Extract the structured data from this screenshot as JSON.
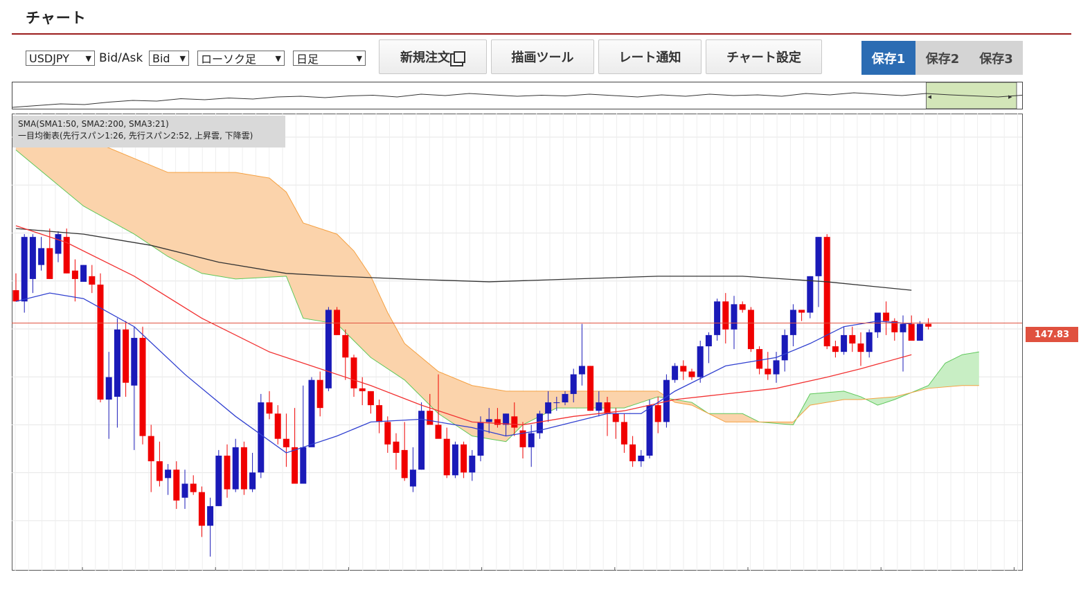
{
  "header": {
    "title": "チャート"
  },
  "toolbar": {
    "symbol_select": "USDJPY",
    "bidask_label": "Bid/Ask",
    "bidask_select": "Bid",
    "chart_type_select": "ローソク足",
    "period_select": "日足",
    "new_order_button": "新規注文",
    "draw_tool_button": "描画ツール",
    "rate_alert_button": "レート通知",
    "chart_settings_button": "チャート設定",
    "save1": "保存1",
    "save2": "保存2",
    "save3": "保存3"
  },
  "legend": {
    "line1": "SMA(SMA1:50, SMA2:200, SMA3:21)",
    "line2": "一目均衡表(先行スパン1:26, 先行スパン2:52, 上昇雲, 下降雲)"
  },
  "current_price": "147.83",
  "colors": {
    "up_candle": "#1a1ab8",
    "down_candle": "#f00000",
    "sma50": "#f23030",
    "sma200": "#333333",
    "sma21": "#3040d0",
    "cloud_down": "#fbd3ab",
    "cloud_up": "#c8eec4",
    "span1": "#5ec85a",
    "span2": "#f5a040",
    "accent": "#2b6cb3",
    "header_rule": "#9b1c1c"
  },
  "chart_data": {
    "type": "candlestick",
    "symbol": "USDJPY",
    "ylim": [
      139.0,
      155.3
    ],
    "y_ticks": [
      "154.46",
      "152.75",
      "151.04",
      "149.33",
      "147.62",
      "145.91",
      "144.20",
      "142.49",
      "140.78"
    ],
    "x_ticks": [
      "2025/04/02",
      "2025/04/23",
      "2025/05/14",
      "2025/06/04",
      "2025/06/25",
      "2025/07/16",
      "2025/08/06",
      "2025/08/25"
    ],
    "current_price": 147.83,
    "candles": [
      [
        149.0,
        149.6,
        148.6,
        148.6
      ],
      [
        148.6,
        151.0,
        148.2,
        150.9
      ],
      [
        149.4,
        151.0,
        148.9,
        150.9
      ],
      [
        149.9,
        150.9,
        149.7,
        150.5
      ],
      [
        150.5,
        151.2,
        149.4,
        149.4
      ],
      [
        150.3,
        151.1,
        150.0,
        151.0
      ],
      [
        150.9,
        151.2,
        149.6,
        149.6
      ],
      [
        149.7,
        150.1,
        148.6,
        149.4
      ],
      [
        149.3,
        149.9,
        149.4,
        149.9
      ],
      [
        149.5,
        149.9,
        148.9,
        149.2
      ],
      [
        149.2,
        149.6,
        145.0,
        145.1
      ],
      [
        145.1,
        146.8,
        143.7,
        145.9
      ],
      [
        145.2,
        148.0,
        144.1,
        147.6
      ],
      [
        147.6,
        147.9,
        145.2,
        145.7
      ],
      [
        145.6,
        147.7,
        143.3,
        147.3
      ],
      [
        147.3,
        147.7,
        143.5,
        143.8
      ],
      [
        143.8,
        144.2,
        141.8,
        142.9
      ],
      [
        142.9,
        143.6,
        142.0,
        142.2
      ],
      [
        142.3,
        142.8,
        141.7,
        142.6
      ],
      [
        142.6,
        142.9,
        141.2,
        141.5
      ],
      [
        141.6,
        142.6,
        141.2,
        142.1
      ],
      [
        142.1,
        142.4,
        141.7,
        141.8
      ],
      [
        141.8,
        142.0,
        140.2,
        140.6
      ],
      [
        140.6,
        141.6,
        139.5,
        141.3
      ],
      [
        141.3,
        143.3,
        141.3,
        143.1
      ],
      [
        143.1,
        143.5,
        141.6,
        141.9
      ],
      [
        141.9,
        143.7,
        141.8,
        143.4
      ],
      [
        143.4,
        143.6,
        141.7,
        141.9
      ],
      [
        141.9,
        143.2,
        141.8,
        142.5
      ],
      [
        142.5,
        145.3,
        142.3,
        145.0
      ],
      [
        145.0,
        145.4,
        144.4,
        144.6
      ],
      [
        144.6,
        144.9,
        143.5,
        143.7
      ],
      [
        143.7,
        144.6,
        142.7,
        143.4
      ],
      [
        143.4,
        144.8,
        142.4,
        142.1
      ],
      [
        142.1,
        145.6,
        143.2,
        143.4
      ],
      [
        143.4,
        145.9,
        143.5,
        145.8
      ],
      [
        145.8,
        146.1,
        144.5,
        144.8
      ],
      [
        145.5,
        148.4,
        145.4,
        148.3
      ],
      [
        148.3,
        148.4,
        147.4,
        147.4
      ],
      [
        147.4,
        147.6,
        145.8,
        146.6
      ],
      [
        146.6,
        146.7,
        145.2,
        145.5
      ],
      [
        145.5,
        145.9,
        144.9,
        145.4
      ],
      [
        145.4,
        145.4,
        144.6,
        144.9
      ],
      [
        144.9,
        145.1,
        143.9,
        144.3
      ],
      [
        144.3,
        144.5,
        143.2,
        143.5
      ],
      [
        143.6,
        143.9,
        142.6,
        143.2
      ],
      [
        143.3,
        144.3,
        142.2,
        142.3
      ],
      [
        142.0,
        143.4,
        141.8,
        142.6
      ],
      [
        142.6,
        145.0,
        142.6,
        144.7
      ],
      [
        144.7,
        145.3,
        144.3,
        144.2
      ],
      [
        144.2,
        146.0,
        143.8,
        143.7
      ],
      [
        143.7,
        144.1,
        142.3,
        142.4
      ],
      [
        142.4,
        143.6,
        142.3,
        143.5
      ],
      [
        143.5,
        143.6,
        142.3,
        142.5
      ],
      [
        142.5,
        143.3,
        142.2,
        143.1
      ],
      [
        143.1,
        144.5,
        142.9,
        144.3
      ],
      [
        144.3,
        144.8,
        143.9,
        144.4
      ],
      [
        144.4,
        144.8,
        144.1,
        144.2
      ],
      [
        144.2,
        144.6,
        143.8,
        144.6
      ],
      [
        144.5,
        145.0,
        143.8,
        144.1
      ],
      [
        144.0,
        144.3,
        143.0,
        143.4
      ],
      [
        143.4,
        144.2,
        142.7,
        143.9
      ],
      [
        143.9,
        144.7,
        143.7,
        144.6
      ],
      [
        144.6,
        145.4,
        144.3,
        145.0
      ],
      [
        145.0,
        145.2,
        144.7,
        145.0
      ],
      [
        145.0,
        145.4,
        144.9,
        145.3
      ],
      [
        145.3,
        146.2,
        145.0,
        146.0
      ],
      [
        146.0,
        147.8,
        145.6,
        146.3
      ],
      [
        146.3,
        146.3,
        144.7,
        144.7
      ],
      [
        144.7,
        145.4,
        144.5,
        145.0
      ],
      [
        145.0,
        145.2,
        143.8,
        144.6
      ],
      [
        144.6,
        144.8,
        143.7,
        144.3
      ],
      [
        144.3,
        144.6,
        143.2,
        143.5
      ],
      [
        143.5,
        143.8,
        142.7,
        142.9
      ],
      [
        142.9,
        143.3,
        142.7,
        143.1
      ],
      [
        143.1,
        145.1,
        143.0,
        144.9
      ],
      [
        144.9,
        145.2,
        143.9,
        144.3
      ],
      [
        144.3,
        146.0,
        144.1,
        145.8
      ],
      [
        145.8,
        146.4,
        145.7,
        146.3
      ],
      [
        146.3,
        146.5,
        145.8,
        146.1
      ],
      [
        146.1,
        146.2,
        145.8,
        145.9
      ],
      [
        145.9,
        147.2,
        145.7,
        147.0
      ],
      [
        147.0,
        147.5,
        146.4,
        147.4
      ],
      [
        147.4,
        148.7,
        147.2,
        148.6
      ],
      [
        148.6,
        148.9,
        147.1,
        147.6
      ],
      [
        147.6,
        148.8,
        146.9,
        148.5
      ],
      [
        148.5,
        148.6,
        148.2,
        148.3
      ],
      [
        148.3,
        148.4,
        146.8,
        146.9
      ],
      [
        146.9,
        147.0,
        146.0,
        146.2
      ],
      [
        146.2,
        146.8,
        145.8,
        146.0
      ],
      [
        146.0,
        146.8,
        145.7,
        146.5
      ],
      [
        146.5,
        147.6,
        146.1,
        147.4
      ],
      [
        147.4,
        148.5,
        147.0,
        148.3
      ],
      [
        148.3,
        148.3,
        147.9,
        148.2
      ],
      [
        148.2,
        149.5,
        148.0,
        149.5
      ],
      [
        149.5,
        150.9,
        148.4,
        150.9
      ],
      [
        150.9,
        151.0,
        146.9,
        147.0
      ],
      [
        147.0,
        147.2,
        146.6,
        146.8
      ],
      [
        146.8,
        147.7,
        146.7,
        147.4
      ],
      [
        147.4,
        147.7,
        146.8,
        147.1
      ],
      [
        147.1,
        147.5,
        146.3,
        146.8
      ],
      [
        146.8,
        147.6,
        146.6,
        147.5
      ],
      [
        147.5,
        148.2,
        147.3,
        148.2
      ],
      [
        148.2,
        148.6,
        147.4,
        147.9
      ],
      [
        147.9,
        148.0,
        147.2,
        147.5
      ],
      [
        147.5,
        148.1,
        146.1,
        147.8
      ],
      [
        147.8,
        148.1,
        147.4,
        147.2
      ],
      [
        147.2,
        147.9,
        147.4,
        147.8
      ],
      [
        147.8,
        148.0,
        147.6,
        147.7
      ]
    ],
    "sma200": [
      [
        0,
        151.2
      ],
      [
        8,
        151.0
      ],
      [
        16,
        150.6
      ],
      [
        24,
        150.0
      ],
      [
        32,
        149.6
      ],
      [
        38,
        149.5
      ],
      [
        46,
        149.4
      ],
      [
        56,
        149.3
      ],
      [
        66,
        149.4
      ],
      [
        76,
        149.5
      ],
      [
        86,
        149.5
      ],
      [
        96,
        149.3
      ],
      [
        106,
        149.0
      ]
    ],
    "sma50": [
      [
        0,
        151.3
      ],
      [
        6,
        150.7
      ],
      [
        14,
        149.5
      ],
      [
        22,
        148.0
      ],
      [
        30,
        146.8
      ],
      [
        36,
        146.2
      ],
      [
        42,
        145.6
      ],
      [
        48,
        144.9
      ],
      [
        54,
        144.3
      ],
      [
        60,
        144.2
      ],
      [
        66,
        144.5
      ],
      [
        72,
        144.7
      ],
      [
        78,
        145.1
      ],
      [
        84,
        145.3
      ],
      [
        90,
        145.5
      ],
      [
        96,
        145.9
      ],
      [
        100,
        146.2
      ],
      [
        106,
        146.7
      ]
    ],
    "sma21": [
      [
        0,
        148.6
      ],
      [
        4,
        148.9
      ],
      [
        8,
        148.7
      ],
      [
        14,
        147.7
      ],
      [
        20,
        146.0
      ],
      [
        26,
        144.5
      ],
      [
        32,
        143.2
      ],
      [
        38,
        143.8
      ],
      [
        42,
        144.3
      ],
      [
        48,
        144.4
      ],
      [
        54,
        144.1
      ],
      [
        58,
        143.8
      ],
      [
        62,
        144.0
      ],
      [
        66,
        144.3
      ],
      [
        70,
        144.6
      ],
      [
        74,
        144.6
      ],
      [
        78,
        145.4
      ],
      [
        84,
        146.3
      ],
      [
        90,
        146.6
      ],
      [
        94,
        147.1
      ],
      [
        98,
        147.7
      ],
      [
        102,
        147.9
      ],
      [
        106,
        147.8
      ]
    ],
    "span1": [
      [
        0,
        154.0
      ],
      [
        4,
        153.0
      ],
      [
        8,
        152.0
      ],
      [
        14,
        151.0
      ],
      [
        18,
        150.2
      ],
      [
        22,
        149.6
      ],
      [
        26,
        149.4
      ],
      [
        32,
        149.5
      ],
      [
        34,
        148.0
      ],
      [
        38,
        147.8
      ],
      [
        42,
        146.6
      ],
      [
        46,
        145.8
      ],
      [
        50,
        144.6
      ],
      [
        54,
        143.8
      ],
      [
        58,
        143.6
      ],
      [
        60,
        144.2
      ],
      [
        64,
        144.8
      ],
      [
        68,
        144.8
      ],
      [
        72,
        144.8
      ],
      [
        76,
        145.2
      ],
      [
        80,
        145.0
      ],
      [
        82,
        144.6
      ],
      [
        86,
        144.6
      ],
      [
        88,
        144.3
      ],
      [
        92,
        144.2
      ],
      [
        94,
        145.3
      ],
      [
        98,
        145.4
      ],
      [
        100,
        145.2
      ],
      [
        102,
        144.9
      ],
      [
        104,
        145.1
      ],
      [
        108,
        145.6
      ],
      [
        110,
        146.4
      ],
      [
        112,
        146.7
      ],
      [
        114,
        146.8
      ]
    ],
    "span2": [
      [
        0,
        154.4
      ],
      [
        4,
        154.5
      ],
      [
        6,
        154.2
      ],
      [
        10,
        154.2
      ],
      [
        14,
        153.7
      ],
      [
        18,
        153.2
      ],
      [
        22,
        153.2
      ],
      [
        26,
        153.2
      ],
      [
        30,
        153.0
      ],
      [
        32,
        152.5
      ],
      [
        34,
        151.4
      ],
      [
        38,
        151.0
      ],
      [
        40,
        150.4
      ],
      [
        42,
        149.5
      ],
      [
        44,
        148.2
      ],
      [
        46,
        147.1
      ],
      [
        50,
        146.1
      ],
      [
        54,
        145.6
      ],
      [
        58,
        145.4
      ],
      [
        62,
        145.4
      ],
      [
        68,
        145.4
      ],
      [
        72,
        145.4
      ],
      [
        76,
        145.4
      ],
      [
        78,
        145.0
      ],
      [
        80,
        144.9
      ],
      [
        84,
        144.3
      ],
      [
        88,
        144.3
      ],
      [
        92,
        144.3
      ],
      [
        94,
        144.9
      ],
      [
        98,
        145.1
      ],
      [
        100,
        145.1
      ],
      [
        104,
        145.2
      ],
      [
        108,
        145.5
      ],
      [
        112,
        145.6
      ],
      [
        114,
        145.6
      ]
    ],
    "cloud_up_start_index": 92,
    "navigator": {
      "series": [
        0.6,
        0.55,
        0.5,
        0.52,
        0.45,
        0.4,
        0.42,
        0.35,
        0.38,
        0.33,
        0.36,
        0.3,
        0.28,
        0.32,
        0.27,
        0.25,
        0.3,
        0.22,
        0.26,
        0.2,
        0.24,
        0.28,
        0.25,
        0.27,
        0.22,
        0.26,
        0.3,
        0.24,
        0.28,
        0.22,
        0.26,
        0.24,
        0.28,
        0.2,
        0.24,
        0.18,
        0.22,
        0.26,
        0.2,
        0.24,
        0.27,
        0.3,
        0.25
      ],
      "window_start": 0.905
    }
  }
}
